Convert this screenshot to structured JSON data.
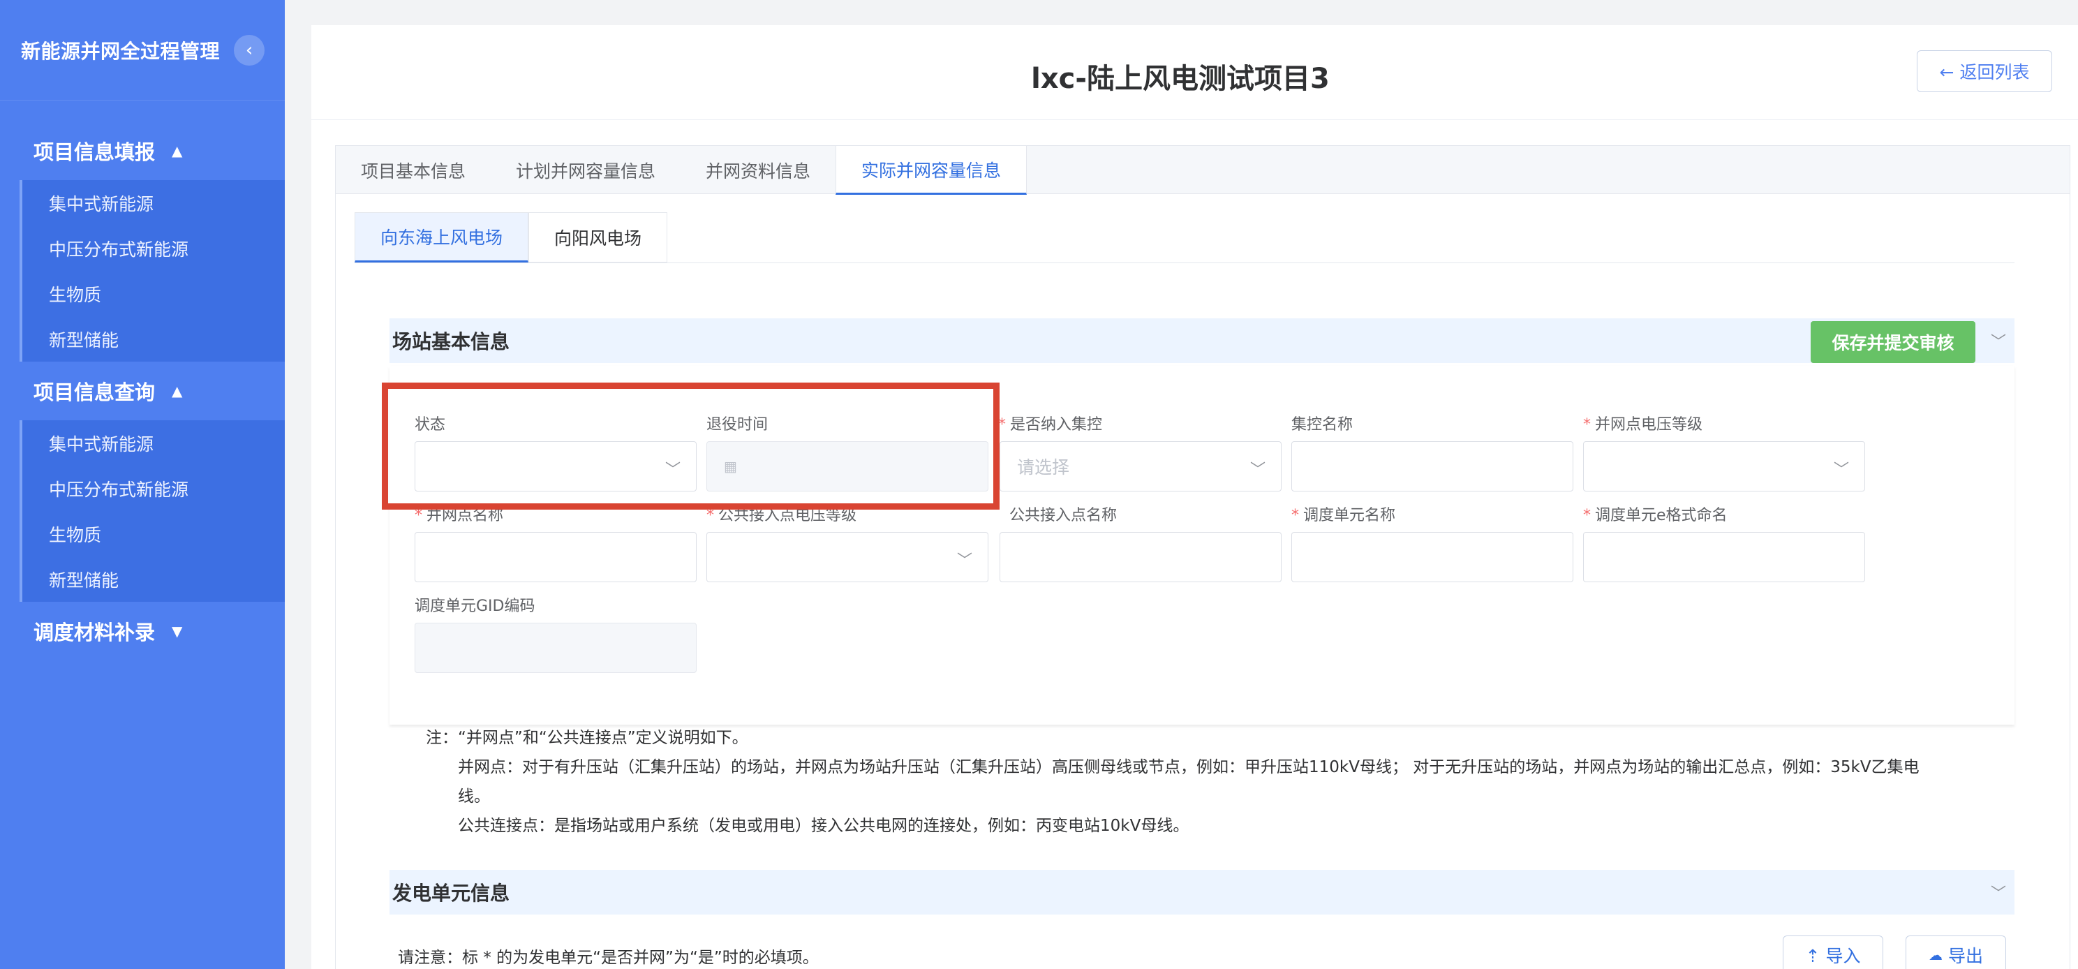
{
  "sidebar": {
    "brand": "新能源并网全过程管理",
    "collapse_icon": "‹",
    "groups": [
      {
        "label": "项目信息填报",
        "arrow": "▲",
        "items": [
          "集中式新能源",
          "中压分布式新能源",
          "生物质",
          "新型储能"
        ]
      },
      {
        "label": "项目信息查询",
        "arrow": "▲",
        "items": [
          "集中式新能源",
          "中压分布式新能源",
          "生物质",
          "新型储能"
        ]
      },
      {
        "label": "调度材料补录",
        "arrow": "▼",
        "items": []
      }
    ]
  },
  "header": {
    "title": "lxc-陆上风电测试项目3",
    "back_label": "← 返回列表"
  },
  "tabs": [
    "项目基本信息",
    "计划并网容量信息",
    "并网资料信息",
    "实际并网容量信息"
  ],
  "subtabs": [
    "向东海上风电场",
    "向阳风电场"
  ],
  "station_section": {
    "title": "场站基本信息",
    "save_label": "保存并提交审核",
    "chevron": "﹀"
  },
  "form": {
    "status": {
      "label": "状态"
    },
    "retire_time": {
      "label": "退役时间"
    },
    "central_control": {
      "label": "是否纳入集控",
      "placeholder": "请选择"
    },
    "control_name": {
      "label": "集控名称"
    },
    "grid_voltage": {
      "label": "并网点电压等级"
    },
    "grid_point_name": {
      "label": "并网点名称"
    },
    "public_voltage": {
      "label": "公共接入点电压等级"
    },
    "public_point_name": {
      "label": "公共接入点名称"
    },
    "dispatch_unit_name": {
      "label": "调度单元名称"
    },
    "dispatch_unit_e": {
      "label": "调度单元e格式命名"
    },
    "dispatch_gid": {
      "label": "调度单元GID编码"
    }
  },
  "note": {
    "line1": "注：“并网点”和“公共连接点”定义说明如下。",
    "line2": "并网点：对于有升压站（汇集升压站）的场站，并网点为场站升压站（汇集升压站）高压侧母线或节点，例如：甲升压站110kV母线；  对于无升压站的场站，并网点为场站的输出汇总点，例如：35kV乙集电",
    "line3": "线。",
    "line4": "公共连接点：是指场站或用户系统（发电或用电）接入公共电网的连接处，例如：丙变电站10kV母线。"
  },
  "unit_section": {
    "title": "发电单元信息",
    "please_note": "请注意：标 * 的为发电单元“是否并网”为“是”时的必填项。",
    "import_label": "⇡ 导入",
    "export_label": "导出",
    "chevron": "﹀"
  }
}
